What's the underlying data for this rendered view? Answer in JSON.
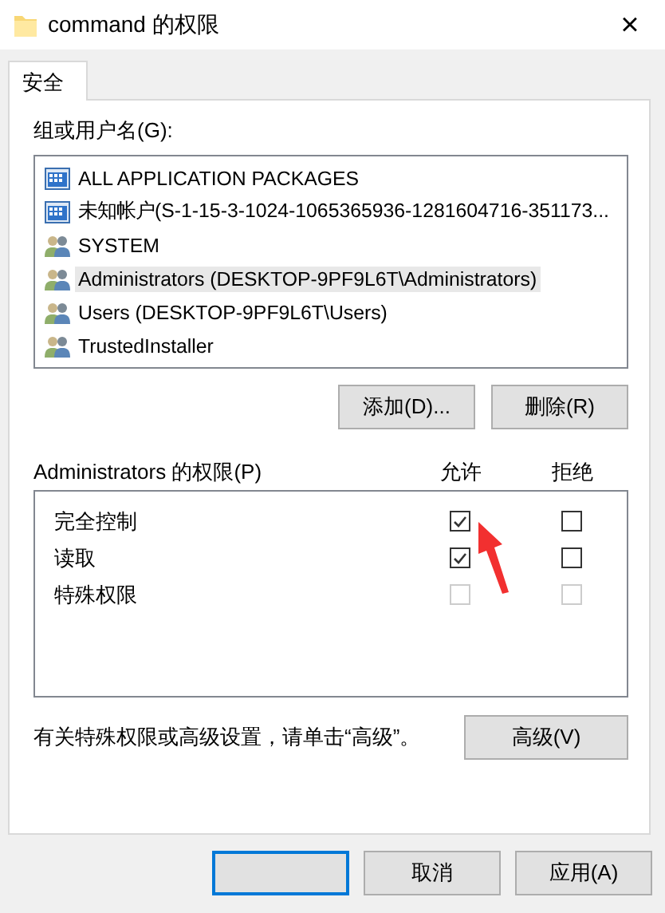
{
  "window": {
    "title": "command 的权限",
    "close": "×"
  },
  "tabs": [
    {
      "label": "安全",
      "selected": true
    }
  ],
  "principals_label": "组或用户名(G):",
  "principals": [
    {
      "name": "ALL APPLICATION PACKAGES",
      "kind": "package",
      "selected": false
    },
    {
      "name": "未知帐户(S-1-15-3-1024-1065365936-1281604716-351173...",
      "kind": "package",
      "selected": false
    },
    {
      "name": "SYSTEM",
      "kind": "group",
      "selected": false
    },
    {
      "name": "Administrators (DESKTOP-9PF9L6T\\Administrators)",
      "kind": "group",
      "selected": true
    },
    {
      "name": "Users (DESKTOP-9PF9L6T\\Users)",
      "kind": "group",
      "selected": false
    },
    {
      "name": "TrustedInstaller",
      "kind": "group",
      "selected": false
    }
  ],
  "principal_buttons": [
    "添加(D)...",
    "删除(R)"
  ],
  "permissions_label": "Administrators 的权限(P)",
  "permission_columns": [
    "允许",
    "拒绝"
  ],
  "permissions": [
    {
      "name": "完全控制",
      "allow": {
        "checked": true,
        "disabled": false
      },
      "deny": {
        "checked": false,
        "disabled": false
      }
    },
    {
      "name": "读取",
      "allow": {
        "checked": true,
        "disabled": false
      },
      "deny": {
        "checked": false,
        "disabled": false
      }
    },
    {
      "name": "特殊权限",
      "allow": {
        "checked": false,
        "disabled": true
      },
      "deny": {
        "checked": false,
        "disabled": true
      }
    }
  ],
  "advanced_note": "有关特殊权限或高级设置，请单击“高级”。",
  "advanced_button": "高级(V)",
  "dialog_buttons": [
    {
      "default": true
    },
    {
      "label": "取消",
      "default": false
    },
    {
      "label": "应用(A)",
      "default": false
    }
  ],
  "annotation": {
    "kind": "arrow"
  }
}
